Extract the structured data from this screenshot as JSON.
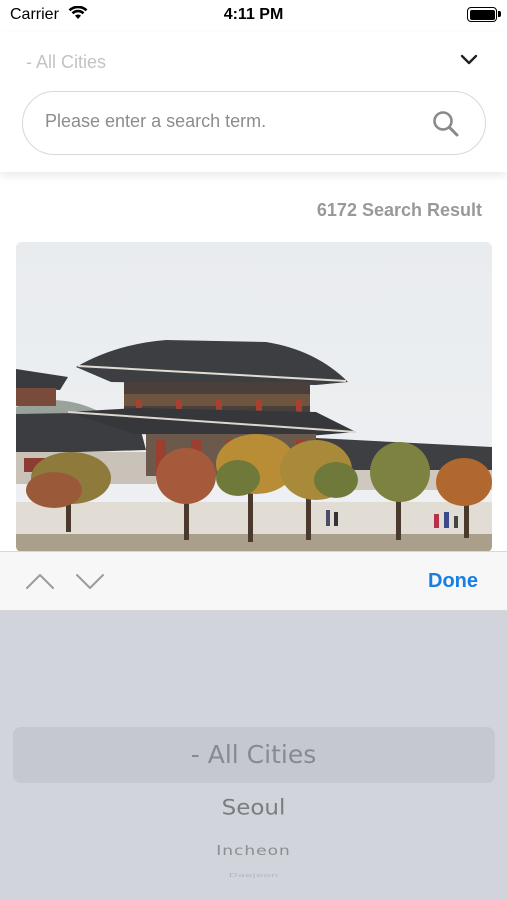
{
  "status_bar": {
    "carrier": "Carrier",
    "time": "4:11 PM"
  },
  "header": {
    "city_select": {
      "selected": "- All Cities",
      "icon": "chevron-down-icon"
    },
    "search": {
      "placeholder": "Please enter a search term.",
      "value": "",
      "icon": "search-icon"
    }
  },
  "results": {
    "count_label": "6172 Search Result"
  },
  "keyboard_toolbar": {
    "done_label": "Done",
    "accent_color": "#1a7ee0"
  },
  "picker": {
    "options": [
      "- All Cities",
      "Seoul",
      "Incheon",
      "Daejeon"
    ],
    "selected_index": 0
  }
}
